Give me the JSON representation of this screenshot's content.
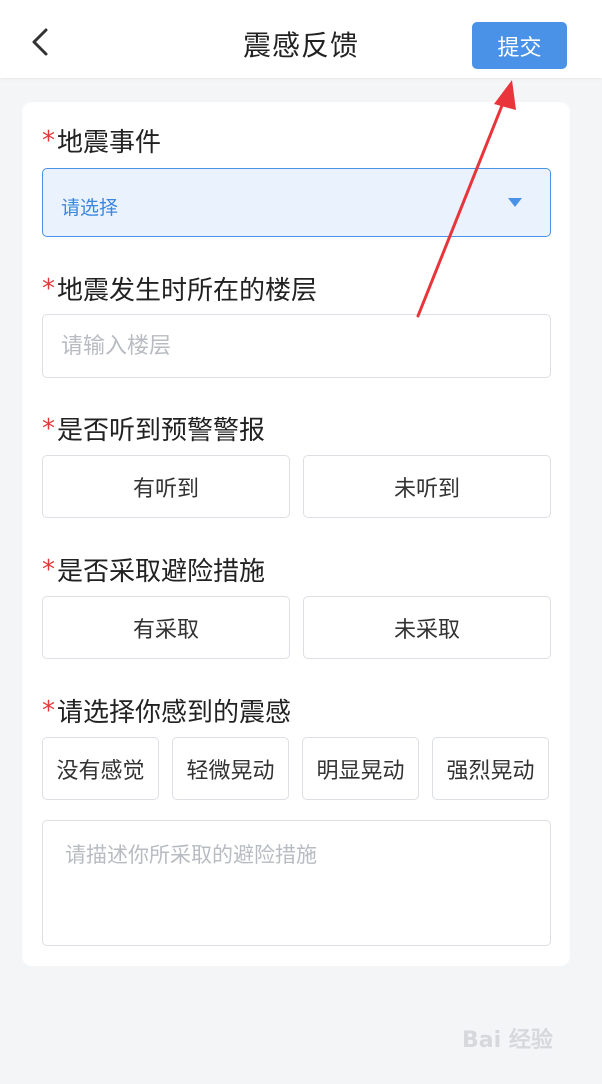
{
  "header": {
    "title": "震感反馈",
    "submit_label": "提交"
  },
  "form": {
    "event": {
      "label": "地震事件",
      "placeholder": "请选择"
    },
    "floor": {
      "label": "地震发生时所在的楼层",
      "placeholder": "请输入楼层"
    },
    "warning": {
      "label": "是否听到预警警报",
      "options": [
        "有听到",
        "未听到"
      ]
    },
    "action": {
      "label": "是否采取避险措施",
      "options": [
        "有采取",
        "未采取"
      ]
    },
    "intensity": {
      "label": "请选择你感到的震感",
      "options": [
        "没有感觉",
        "轻微晃动",
        "明显晃动",
        "强烈晃动"
      ]
    },
    "description": {
      "placeholder": "请描述你所采取的避险措施"
    },
    "required_mark": "*"
  },
  "watermark": "Bai 经验",
  "colors": {
    "accent": "#4a92e8",
    "required": "#e23a3a",
    "annotation_arrow": "#e8343a"
  }
}
